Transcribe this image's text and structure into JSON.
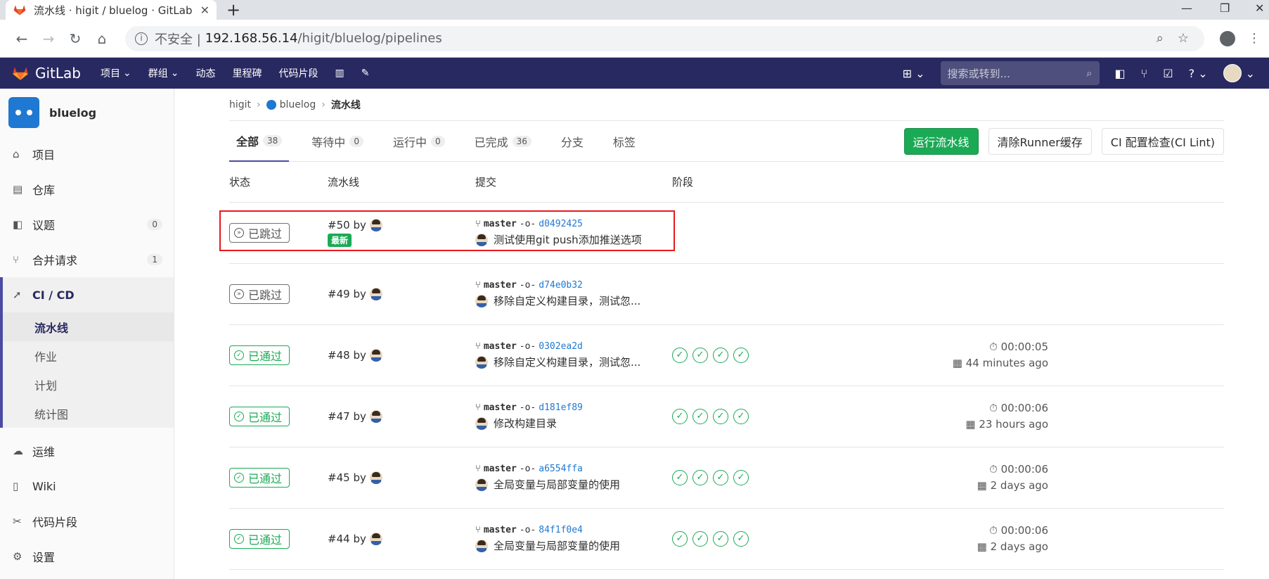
{
  "browser": {
    "tab_title": "流水线 · higit / bluelog · GitLab",
    "tab_close": "✕",
    "new_tab": "+",
    "url_insecure": "不安全 |",
    "url_host": "192.168.56.14",
    "url_path": "/higit/bluelog/pipelines",
    "win_min": "—",
    "win_max": "❐",
    "win_close": "✕"
  },
  "header": {
    "brand": "GitLab",
    "nav": [
      "项目",
      "群组",
      "动态",
      "里程碑",
      "代码片段"
    ],
    "search_placeholder": "搜索或转到..."
  },
  "sidebar": {
    "project_name": "bluelog",
    "items": [
      {
        "label": "项目",
        "icon": "home-icon"
      },
      {
        "label": "仓库",
        "icon": "doc-icon"
      },
      {
        "label": "议题",
        "icon": "issues-icon",
        "count": "0"
      },
      {
        "label": "合并请求",
        "icon": "merge-icon",
        "count": "1"
      },
      {
        "label": "CI / CD",
        "icon": "rocket-icon"
      }
    ],
    "sub_items": [
      "流水线",
      "作业",
      "计划",
      "统计图"
    ],
    "bottom_items": [
      {
        "label": "运维",
        "icon": "cloud-icon"
      },
      {
        "label": "Wiki",
        "icon": "book-icon"
      },
      {
        "label": "代码片段",
        "icon": "scissors-icon"
      },
      {
        "label": "设置",
        "icon": "gear-icon"
      }
    ]
  },
  "breadcrumb": {
    "group": "higit",
    "project": "bluelog",
    "current": "流水线"
  },
  "tabs": [
    {
      "label": "全部",
      "count": "38"
    },
    {
      "label": "等待中",
      "count": "0"
    },
    {
      "label": "运行中",
      "count": "0"
    },
    {
      "label": "已完成",
      "count": "36"
    },
    {
      "label": "分支"
    },
    {
      "label": "标签"
    }
  ],
  "buttons": {
    "run": "运行流水线",
    "clear": "清除Runner缓存",
    "lint": "CI 配置检查(CI Lint)"
  },
  "columns": {
    "status": "状态",
    "pipeline": "流水线",
    "commit": "提交",
    "stages": "阶段"
  },
  "colors": {
    "accent": "#292961",
    "success": "#1aaa55",
    "link": "#1f78d1",
    "highlight": "#e5191e"
  },
  "pipelines": [
    {
      "status": "已跳过",
      "id": "#50",
      "by": "by",
      "latest": "最新",
      "branch": "master",
      "sha": "d0492425",
      "message": "测试使用git push添加推送选项",
      "duration": "",
      "ago": ""
    },
    {
      "status": "已跳过",
      "id": "#49",
      "by": "by",
      "branch": "master",
      "sha": "d74e0b32",
      "message": "移除自定义构建目录，测试忽...",
      "duration": "",
      "ago": ""
    },
    {
      "status": "已通过",
      "id": "#48",
      "by": "by",
      "branch": "master",
      "sha": "0302ea2d",
      "message": "移除自定义构建目录，测试忽...",
      "duration": "00:00:05",
      "ago": "44 minutes ago"
    },
    {
      "status": "已通过",
      "id": "#47",
      "by": "by",
      "branch": "master",
      "sha": "d181ef89",
      "message": "修改构建目录",
      "duration": "00:00:06",
      "ago": "23 hours ago"
    },
    {
      "status": "已通过",
      "id": "#45",
      "by": "by",
      "branch": "master",
      "sha": "a6554ffa",
      "message": "全局变量与局部变量的使用",
      "duration": "00:00:06",
      "ago": "2 days ago"
    },
    {
      "status": "已通过",
      "id": "#44",
      "by": "by",
      "branch": "master",
      "sha": "84f1f0e4",
      "message": "全局变量与局部变量的使用",
      "duration": "00:00:06",
      "ago": "2 days ago"
    }
  ]
}
